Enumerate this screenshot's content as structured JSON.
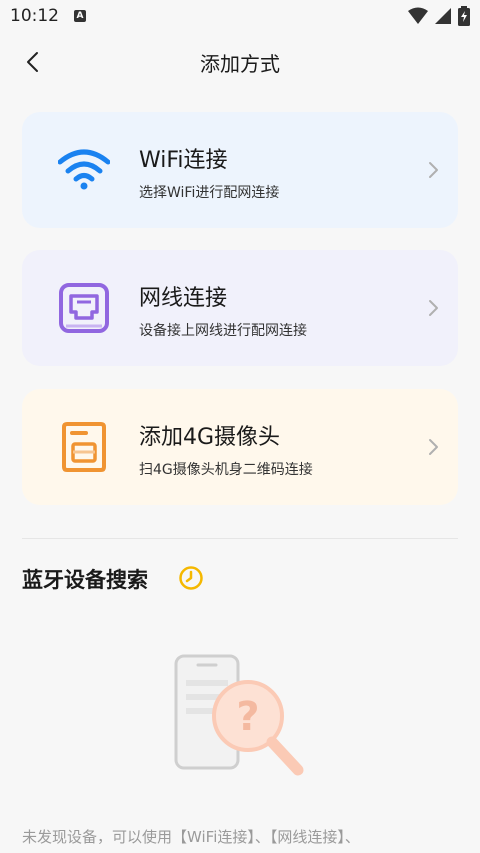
{
  "status_bar": {
    "time": "10:12",
    "notification_icon": "a-letter-icon"
  },
  "header": {
    "title": "添加方式",
    "back_icon": "chevron-left-icon"
  },
  "cards": [
    {
      "title": "WiFi连接",
      "desc": "选择WiFi进行配网连接",
      "icon": "wifi-icon",
      "bg": "#edf4fd",
      "accent": "#1a82f0"
    },
    {
      "title": "网线连接",
      "desc": "设备接上网线进行配网连接",
      "icon": "ethernet-port-icon",
      "bg": "#f1f1fb",
      "accent": "#9167e0"
    },
    {
      "title": "添加4G摄像头",
      "desc": "扫4G摄像头机身二维码连接",
      "icon": "sim-card-icon",
      "bg": "#fff8ec",
      "accent": "#f09432"
    }
  ],
  "bluetooth": {
    "title": "蓝牙设备搜索",
    "icon": "clock-icon",
    "accent": "#f5b800"
  },
  "empty_state": {
    "text": "未发现设备，可以使用【WiFi连接】、【网线连接】、",
    "illustration": "phone-search-illustration"
  }
}
